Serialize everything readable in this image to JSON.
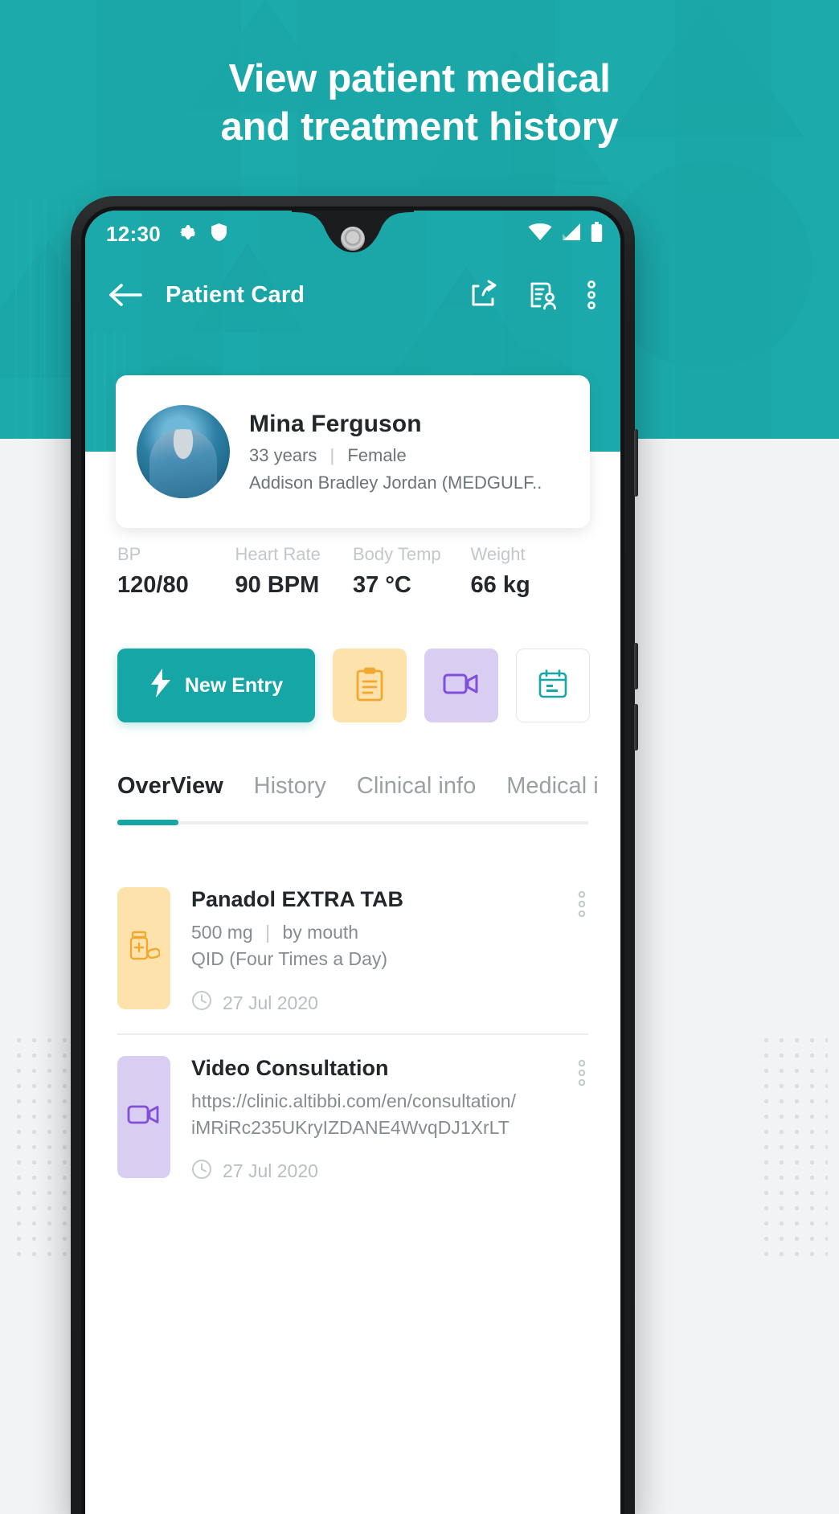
{
  "promo": {
    "title_line1": "View patient medical",
    "title_line2": "and treatment history",
    "bg_color": "#1ba7a8"
  },
  "statusbar": {
    "time": "12:30",
    "icons": [
      "gear-icon",
      "shield-icon",
      "wifi-icon",
      "signal-icon",
      "battery-icon"
    ]
  },
  "appbar": {
    "back_icon": "arrow-left-icon",
    "title": "Patient Card",
    "actions": [
      "share-icon",
      "patient-record-icon",
      "overflow-menu-icon"
    ]
  },
  "patient": {
    "name": "Mina Ferguson",
    "age": "33 years",
    "separator": "|",
    "gender": "Female",
    "insurance": "Addison Bradley Jordan (MEDGULF.."
  },
  "vitals": [
    {
      "label": "BP",
      "value": "120/80"
    },
    {
      "label": "Heart Rate",
      "value": "90 BPM"
    },
    {
      "label": "Body Temp",
      "value": "37 °C"
    },
    {
      "label": "Weight",
      "value": "66 kg"
    }
  ],
  "actions": {
    "new_entry_label": "New Entry",
    "new_entry_icon": "lightning-bolt-icon",
    "new_entry_color": "#16a6a6",
    "buttons": [
      {
        "icon": "clipboard-icon",
        "color": "#fde3ab"
      },
      {
        "icon": "video-camera-icon",
        "color": "#d9cdf2"
      },
      {
        "icon": "calendar-icon",
        "color": "#ffffff"
      }
    ]
  },
  "tabs": [
    {
      "label": "OverView",
      "active": true
    },
    {
      "label": "History",
      "active": false
    },
    {
      "label": "Clinical info",
      "active": false
    },
    {
      "label": "Medical i",
      "active": false
    }
  ],
  "list": [
    {
      "icon": "medicine-bottle-icon",
      "chip_color": "#fde3ab",
      "title": "Panadol EXTRA TAB",
      "sub_line1_a": "500 mg",
      "sub_sep": "|",
      "sub_line1_b": "by mouth",
      "sub_line2": "QID (Four Times a Day)",
      "date": "27 Jul 2020",
      "date_icon": "clock-icon",
      "menu_icon": "overflow-menu-icon"
    },
    {
      "icon": "video-camera-icon",
      "chip_color": "#d9cdf2",
      "title": "Video Consultation",
      "sub_line1_a": "https://clinic.altibbi.com/en/consultation/",
      "sub_sep": "",
      "sub_line1_b": "",
      "sub_line2": "iMRiRc235UKryIZDANE4WvqDJ1XrLT",
      "date": "27 Jul 2020",
      "date_icon": "clock-icon",
      "menu_icon": "overflow-menu-icon"
    }
  ]
}
